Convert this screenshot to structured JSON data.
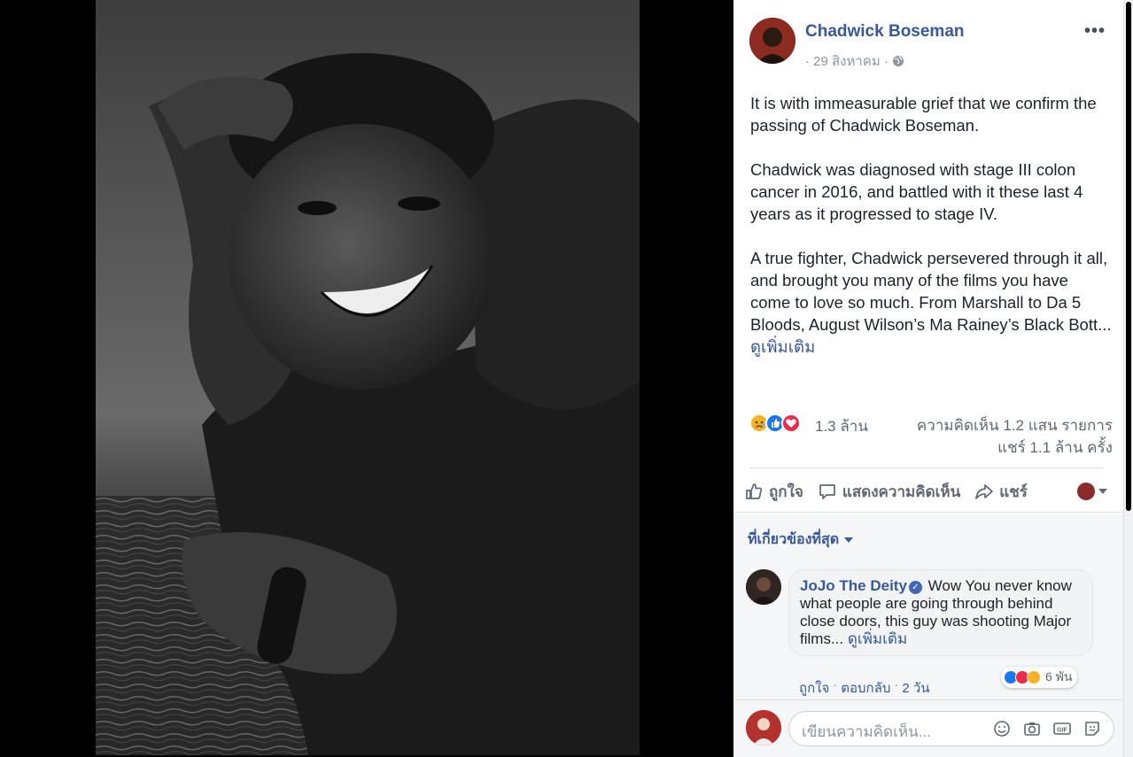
{
  "post": {
    "author": "Chadwick Boseman",
    "date": "· 29 สิงหาคม ·",
    "more_label": "•••",
    "paragraphs": [
      "It is with immeasurable grief that we confirm the passing of Chadwick Boseman.",
      "Chadwick was diagnosed with stage III colon cancer in 2016, and battled with it these last 4 years as it progressed to stage IV.",
      "A true fighter, Chadwick persevered through it all, and brought you many of the films you have come to love so much. From Marshall to Da 5 Bloods, August Wilson’s Ma Rainey’s Black Bott..."
    ],
    "see_more": "ดูเพิ่มเติม"
  },
  "stats": {
    "reactions": "1.3 ล้าน",
    "comments": "ความคิดเห็น 1.2 แสน รายการ",
    "shares": "แชร์ 1.1 ล้าน ครั้ง"
  },
  "actions": {
    "like": "ถูกใจ",
    "comment": "แสดงความคิดเห็น",
    "share": "แชร์"
  },
  "relevance": "ที่เกี่ยวข้องที่สุด",
  "comment": {
    "author": "JoJo The Deity",
    "text": "Wow You never know\nwhat people are going through behind close doors, this guy was shooting Major films...",
    "see_more": "ดูเพิ่มเติม",
    "reaction_count": "6 พัน",
    "like": "ถูกใจ",
    "reply": "ตอบกลับ",
    "time": "2 วัน"
  },
  "composer": {
    "placeholder": "เขียนความคิดเห็น..."
  },
  "colors": {
    "link": "#385898",
    "like": "#1877f2",
    "love": "#f02849",
    "sad": "#f7b125"
  }
}
